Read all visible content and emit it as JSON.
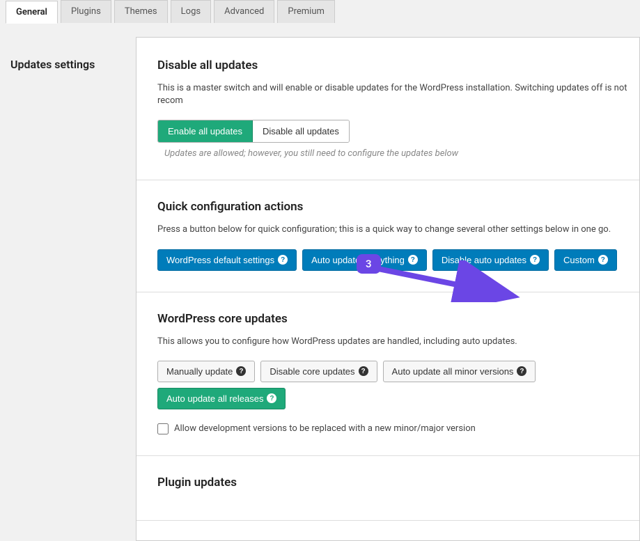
{
  "tabs": {
    "general": "General",
    "plugins": "Plugins",
    "themes": "Themes",
    "logs": "Logs",
    "advanced": "Advanced",
    "premium": "Premium"
  },
  "sidebar": {
    "title": "Updates settings"
  },
  "section1": {
    "title": "Disable all updates",
    "desc": "This is a master switch and will enable or disable updates for the WordPress installation. Switching updates off is not recom",
    "enable": "Enable all updates",
    "disable": "Disable all updates",
    "note": "Updates are allowed; however, you still need to configure the updates below"
  },
  "section2": {
    "title": "Quick configuration actions",
    "desc": "Press a button below for quick configuration; this is a quick way to change several other settings below in one go.",
    "btn1": "WordPress default settings",
    "btn2": "Auto update everything",
    "btn3": "Disable auto updates",
    "btn4": "Custom"
  },
  "section3": {
    "title": "WordPress core updates",
    "desc": "This allows you to configure how WordPress updates are handled, including auto updates.",
    "btn1": "Manually update",
    "btn2": "Disable core updates",
    "btn3": "Auto update all minor versions",
    "btn4": "Auto update all releases",
    "checkbox": "Allow development versions to be replaced with a new minor/major version"
  },
  "section4": {
    "title": "Plugin updates"
  },
  "annotation": {
    "step": "3"
  }
}
